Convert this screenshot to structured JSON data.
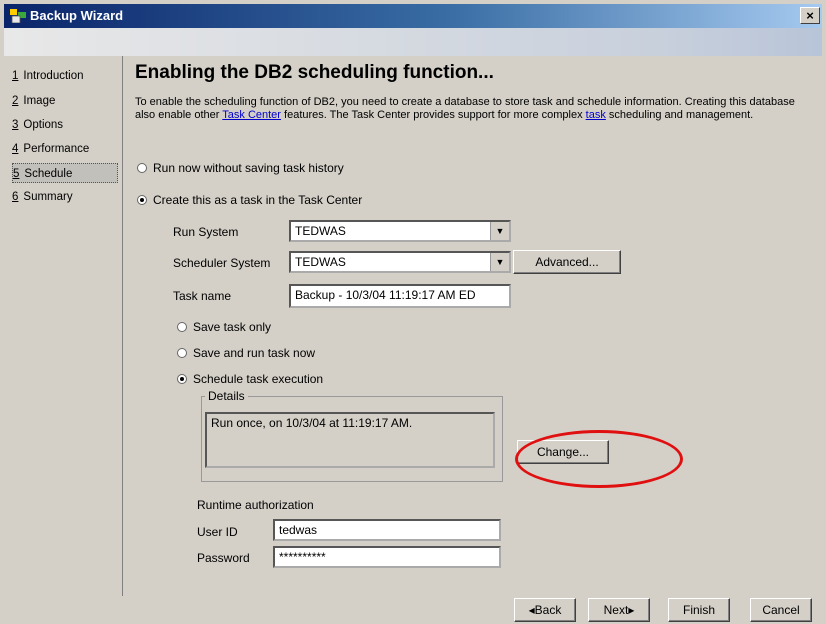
{
  "window": {
    "title": "Backup Wizard",
    "close_label": "×"
  },
  "nav": {
    "items": [
      {
        "num": "1",
        "label": "Introduction"
      },
      {
        "num": "2",
        "label": "Image"
      },
      {
        "num": "3",
        "label": "Options"
      },
      {
        "num": "4",
        "label": "Performance"
      },
      {
        "num": "5",
        "label": "Schedule"
      },
      {
        "num": "6",
        "label": "Summary"
      }
    ],
    "active_index": 4
  },
  "main": {
    "heading": "Enabling the DB2 scheduling function...",
    "desc_part1": "To enable the scheduling function of DB2, you need to create a database to store task and schedule information. Creating this database also enable other ",
    "desc_link1": "Task Center",
    "desc_part2": " features. The Task Center provides support for more complex ",
    "desc_link2": "task",
    "desc_part3": " scheduling and management.",
    "radio_run_now": "Run now without saving task history",
    "radio_create_task": "Create this as a task in the Task Center",
    "run_system_label": "Run System",
    "run_system_value": "TEDWAS",
    "scheduler_system_label": "Scheduler System",
    "scheduler_system_value": "TEDWAS",
    "advanced_button": "Advanced...",
    "task_name_label": "Task name",
    "task_name_value": "Backup - 10/3/04 11:19:17 AM ED",
    "radio_save_only": "Save task only",
    "radio_save_run": "Save and run task now",
    "radio_schedule": "Schedule task execution",
    "details_title": "Details",
    "details_text": "Run once, on 10/3/04 at 11:19:17 AM.",
    "change_button": "Change...",
    "runtime_auth_label": "Runtime authorization",
    "user_id_label": "User ID",
    "user_id_value": "tedwas",
    "password_label": "Password",
    "password_value": "**********"
  },
  "footer": {
    "back": "◂Back",
    "next": "Next▸",
    "finish": "Finish",
    "cancel": "Cancel"
  },
  "colors": {
    "highlight_circle": "#e01010",
    "link": "#0000cc"
  }
}
